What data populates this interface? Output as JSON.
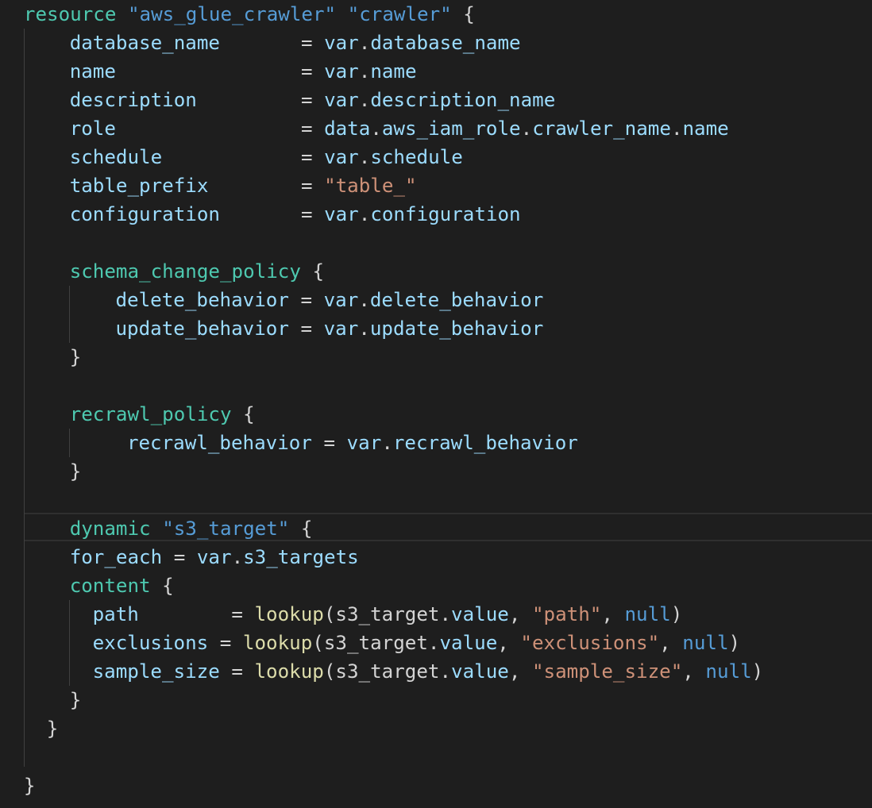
{
  "editor": {
    "lines": [
      {
        "indent": 1,
        "tokens": [
          {
            "t": "resource ",
            "c": "kw"
          },
          {
            "t": "\"aws_glue_crawler\"",
            "c": "strb"
          },
          {
            "t": " ",
            "c": "punc"
          },
          {
            "t": "\"crawler\"",
            "c": "strb"
          },
          {
            "t": " {",
            "c": "punc"
          }
        ]
      },
      {
        "indent": 3,
        "tokens": [
          {
            "t": "database_name       ",
            "c": "attr"
          },
          {
            "t": "= ",
            "c": "punc"
          },
          {
            "t": "var",
            "c": "attr"
          },
          {
            "t": ".",
            "c": "punc"
          },
          {
            "t": "database_name",
            "c": "attr"
          }
        ]
      },
      {
        "indent": 3,
        "tokens": [
          {
            "t": "name                ",
            "c": "attr"
          },
          {
            "t": "= ",
            "c": "punc"
          },
          {
            "t": "var",
            "c": "attr"
          },
          {
            "t": ".",
            "c": "punc"
          },
          {
            "t": "name",
            "c": "attr"
          }
        ]
      },
      {
        "indent": 3,
        "tokens": [
          {
            "t": "description         ",
            "c": "attr"
          },
          {
            "t": "= ",
            "c": "punc"
          },
          {
            "t": "var",
            "c": "attr"
          },
          {
            "t": ".",
            "c": "punc"
          },
          {
            "t": "description_name",
            "c": "attr"
          }
        ]
      },
      {
        "indent": 3,
        "tokens": [
          {
            "t": "role                ",
            "c": "attr"
          },
          {
            "t": "= ",
            "c": "punc"
          },
          {
            "t": "data",
            "c": "attr"
          },
          {
            "t": ".",
            "c": "punc"
          },
          {
            "t": "aws_iam_role",
            "c": "attr"
          },
          {
            "t": ".",
            "c": "punc"
          },
          {
            "t": "crawler_name",
            "c": "attr"
          },
          {
            "t": ".",
            "c": "punc"
          },
          {
            "t": "name",
            "c": "attr"
          }
        ]
      },
      {
        "indent": 3,
        "tokens": [
          {
            "t": "schedule            ",
            "c": "attr"
          },
          {
            "t": "= ",
            "c": "punc"
          },
          {
            "t": "var",
            "c": "attr"
          },
          {
            "t": ".",
            "c": "punc"
          },
          {
            "t": "schedule",
            "c": "attr"
          }
        ]
      },
      {
        "indent": 3,
        "tokens": [
          {
            "t": "table_prefix        ",
            "c": "attr"
          },
          {
            "t": "= ",
            "c": "punc"
          },
          {
            "t": "\"table_\"",
            "c": "str"
          }
        ]
      },
      {
        "indent": 3,
        "tokens": [
          {
            "t": "configuration       ",
            "c": "attr"
          },
          {
            "t": "= ",
            "c": "punc"
          },
          {
            "t": "var",
            "c": "attr"
          },
          {
            "t": ".",
            "c": "punc"
          },
          {
            "t": "configuration",
            "c": "attr"
          }
        ]
      },
      {
        "indent": 0,
        "tokens": []
      },
      {
        "indent": 3,
        "tokens": [
          {
            "t": "schema_change_policy",
            "c": "kw"
          },
          {
            "t": " {",
            "c": "punc"
          }
        ]
      },
      {
        "indent": 5,
        "tokens": [
          {
            "t": "delete_behavior ",
            "c": "attr"
          },
          {
            "t": "= ",
            "c": "punc"
          },
          {
            "t": "var",
            "c": "attr"
          },
          {
            "t": ".",
            "c": "punc"
          },
          {
            "t": "delete_behavior",
            "c": "attr"
          }
        ]
      },
      {
        "indent": 5,
        "tokens": [
          {
            "t": "update_behavior ",
            "c": "attr"
          },
          {
            "t": "= ",
            "c": "punc"
          },
          {
            "t": "var",
            "c": "attr"
          },
          {
            "t": ".",
            "c": "punc"
          },
          {
            "t": "update_behavior",
            "c": "attr"
          }
        ]
      },
      {
        "indent": 3,
        "tokens": [
          {
            "t": "}",
            "c": "punc"
          }
        ]
      },
      {
        "indent": 0,
        "tokens": []
      },
      {
        "indent": 3,
        "tokens": [
          {
            "t": "recrawl_policy",
            "c": "kw"
          },
          {
            "t": " {",
            "c": "punc"
          }
        ]
      },
      {
        "indent": 5.5,
        "tokens": [
          {
            "t": "recrawl_behavior ",
            "c": "attr"
          },
          {
            "t": "= ",
            "c": "punc"
          },
          {
            "t": "var",
            "c": "attr"
          },
          {
            "t": ".",
            "c": "punc"
          },
          {
            "t": "recrawl_behavior",
            "c": "attr"
          }
        ]
      },
      {
        "indent": 3,
        "tokens": [
          {
            "t": "}",
            "c": "punc"
          }
        ]
      },
      {
        "indent": 0,
        "tokens": []
      },
      {
        "indent": 3,
        "tokens": [
          {
            "t": "dynamic ",
            "c": "kw"
          },
          {
            "t": "\"s3_target\"",
            "c": "strb"
          },
          {
            "t": " {",
            "c": "punc"
          }
        ]
      },
      {
        "indent": 3,
        "tokens": [
          {
            "t": "for_each ",
            "c": "attr"
          },
          {
            "t": "= ",
            "c": "punc"
          },
          {
            "t": "var",
            "c": "attr"
          },
          {
            "t": ".",
            "c": "punc"
          },
          {
            "t": "s3_targets",
            "c": "attr"
          }
        ]
      },
      {
        "indent": 3,
        "tokens": [
          {
            "t": "content",
            "c": "kw"
          },
          {
            "t": " {",
            "c": "punc"
          }
        ]
      },
      {
        "indent": 4,
        "tokens": [
          {
            "t": "path        ",
            "c": "attr"
          },
          {
            "t": "= ",
            "c": "punc"
          },
          {
            "t": "lookup",
            "c": "fn"
          },
          {
            "t": "(",
            "c": "punc"
          },
          {
            "t": "s3_target",
            "c": "punc"
          },
          {
            "t": ".",
            "c": "punc"
          },
          {
            "t": "value",
            "c": "attr"
          },
          {
            "t": ", ",
            "c": "punc"
          },
          {
            "t": "\"path\"",
            "c": "str"
          },
          {
            "t": ", ",
            "c": "punc"
          },
          {
            "t": "null",
            "c": "null"
          },
          {
            "t": ")",
            "c": "punc"
          }
        ]
      },
      {
        "indent": 4,
        "tokens": [
          {
            "t": "exclusions ",
            "c": "attr"
          },
          {
            "t": "= ",
            "c": "punc"
          },
          {
            "t": "lookup",
            "c": "fn"
          },
          {
            "t": "(",
            "c": "punc"
          },
          {
            "t": "s3_target",
            "c": "punc"
          },
          {
            "t": ".",
            "c": "punc"
          },
          {
            "t": "value",
            "c": "attr"
          },
          {
            "t": ", ",
            "c": "punc"
          },
          {
            "t": "\"exclusions\"",
            "c": "str"
          },
          {
            "t": ", ",
            "c": "punc"
          },
          {
            "t": "null",
            "c": "null"
          },
          {
            "t": ")",
            "c": "punc"
          }
        ]
      },
      {
        "indent": 4,
        "tokens": [
          {
            "t": "sample_size ",
            "c": "attr"
          },
          {
            "t": "= ",
            "c": "punc"
          },
          {
            "t": "lookup",
            "c": "fn"
          },
          {
            "t": "(",
            "c": "punc"
          },
          {
            "t": "s3_target",
            "c": "punc"
          },
          {
            "t": ".",
            "c": "punc"
          },
          {
            "t": "value",
            "c": "attr"
          },
          {
            "t": ", ",
            "c": "punc"
          },
          {
            "t": "\"sample_size\"",
            "c": "str"
          },
          {
            "t": ", ",
            "c": "punc"
          },
          {
            "t": "null",
            "c": "null"
          },
          {
            "t": ")",
            "c": "punc"
          }
        ]
      },
      {
        "indent": 3,
        "tokens": [
          {
            "t": "}",
            "c": "punc"
          }
        ]
      },
      {
        "indent": 2,
        "tokens": [
          {
            "t": "}",
            "c": "punc"
          }
        ]
      },
      {
        "indent": 0,
        "tokens": []
      },
      {
        "indent": 1,
        "tokens": [
          {
            "t": "}",
            "c": "punc"
          }
        ]
      }
    ]
  }
}
